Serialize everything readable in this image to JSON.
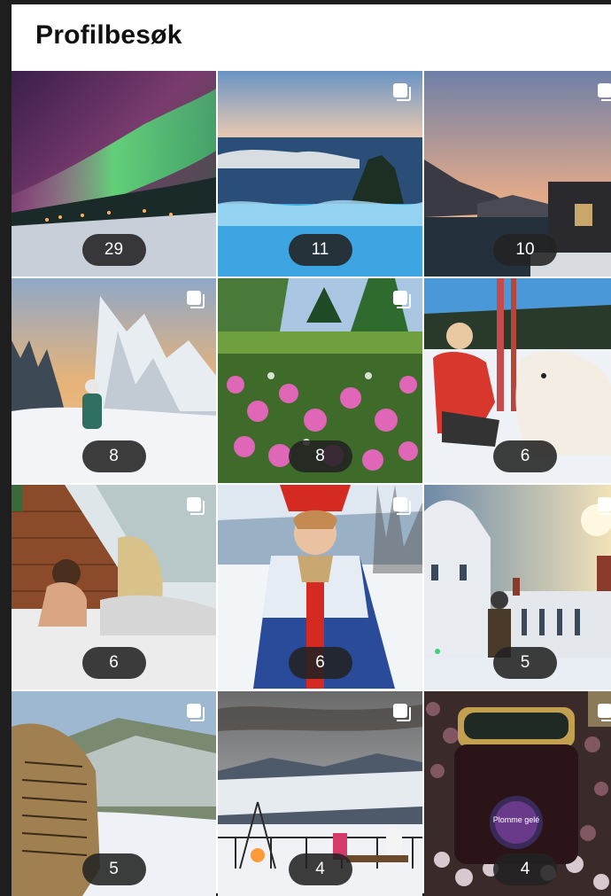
{
  "header": {
    "title": "Profilbesøk"
  },
  "tiles": [
    {
      "count": "29",
      "multi": false
    },
    {
      "count": "11",
      "multi": true
    },
    {
      "count": "10",
      "multi": true
    },
    {
      "count": "8",
      "multi": true
    },
    {
      "count": "8",
      "multi": true
    },
    {
      "count": "6",
      "multi": false
    },
    {
      "count": "6",
      "multi": true
    },
    {
      "count": "6",
      "multi": true
    },
    {
      "count": "5",
      "multi": true
    },
    {
      "count": "5",
      "multi": true
    },
    {
      "count": "4",
      "multi": true
    },
    {
      "count": "4",
      "multi": true
    }
  ],
  "images": {
    "jar_label": "Plomme gelé"
  }
}
